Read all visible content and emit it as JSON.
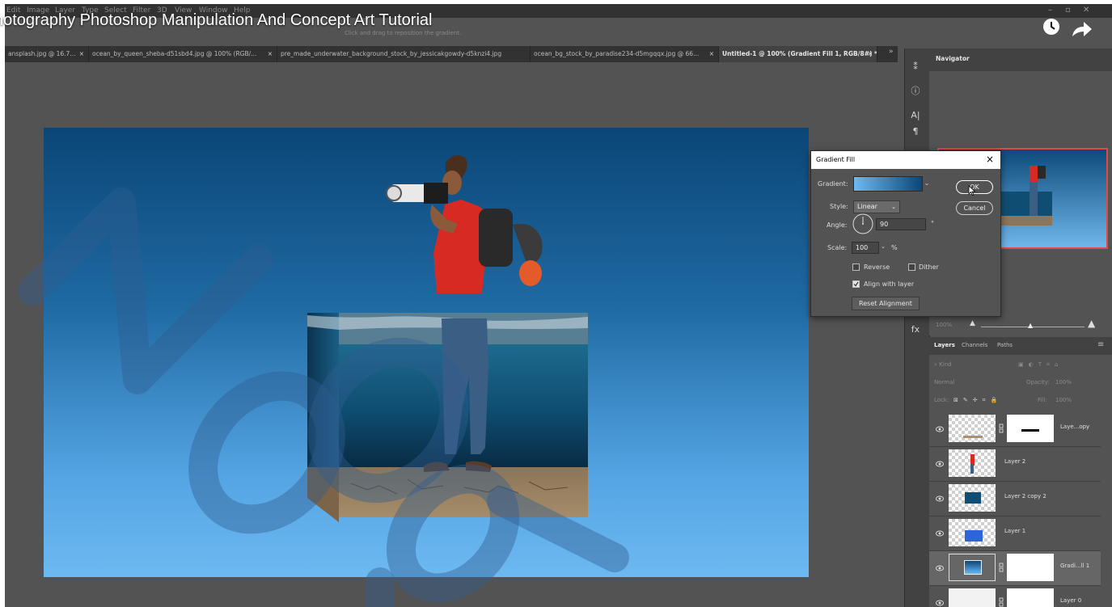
{
  "menubar": {
    "items": [
      "Edit",
      "Image",
      "Layer",
      "Type",
      "Select",
      "Filter",
      "3D",
      "View",
      "Window",
      "Help"
    ]
  },
  "video": {
    "title": "hotography Photoshop Manipulation And Concept Art Tutorial"
  },
  "options_bar": {
    "hint": "Click and drag to reposition the gradient."
  },
  "tabs": [
    {
      "label": "ansplash.jpg @ 16.7...",
      "close": "×",
      "active": false
    },
    {
      "label": "ocean_by_queen_sheba-d51sbd4.jpg @ 100% (RGB/...",
      "close": "×",
      "active": false
    },
    {
      "label": "pre_made_underwater_background_stock_by_jessicakgowdy-d5knzi4.jpg",
      "close": "×",
      "active": false
    },
    {
      "label": "ocean_bg_stock_by_paradise234-d5mgqqx.jpg @ 66...",
      "close": "×",
      "active": false
    },
    {
      "label": "Untitled-1 @ 100% (Gradient Fill 1, RGB/8#) *",
      "close": "×",
      "active": true
    }
  ],
  "tabs_more": "»",
  "navigator": {
    "tab": "Navigator",
    "zoom": "100%"
  },
  "layers_panel": {
    "tabs": [
      "Layers",
      "Channels",
      "Paths"
    ],
    "kind_filter": "Kind",
    "blend_mode": "Normal",
    "opacity_label": "Opacity:",
    "opacity_value": "100%",
    "lock_label": "Lock:",
    "fill_label": "Fill:",
    "fill_value": "100%",
    "layers": [
      {
        "name": "Laye...opy",
        "selected": false
      },
      {
        "name": "Layer 2",
        "selected": false
      },
      {
        "name": "Layer 2 copy 2",
        "selected": false
      },
      {
        "name": "Layer 1",
        "selected": false
      },
      {
        "name": "Gradi...ll 1",
        "selected": true
      },
      {
        "name": "Layer 0",
        "selected": false
      }
    ]
  },
  "dialog": {
    "title": "Gradient Fill",
    "close": "×",
    "gradient_label": "Gradient:",
    "style_label": "Style:",
    "style_value": "Linear",
    "angle_label": "Angle:",
    "angle_value": "90",
    "angle_unit": "°",
    "scale_label": "Scale:",
    "scale_value": "100",
    "scale_unit": "%",
    "reverse_label": "Reverse",
    "reverse_checked": false,
    "dither_label": "Dither",
    "dither_checked": false,
    "align_label": "Align with layer",
    "align_checked": true,
    "reset_label": "Reset Alignment",
    "ok_label": "OK",
    "cancel_label": "Cancel",
    "gradient_start": "#6db9f1",
    "gradient_end": "#0b4677"
  },
  "colors": {
    "canvas_top": "#0b4677",
    "canvas_bottom": "#6db9f1",
    "shirt": "#d62a22"
  }
}
